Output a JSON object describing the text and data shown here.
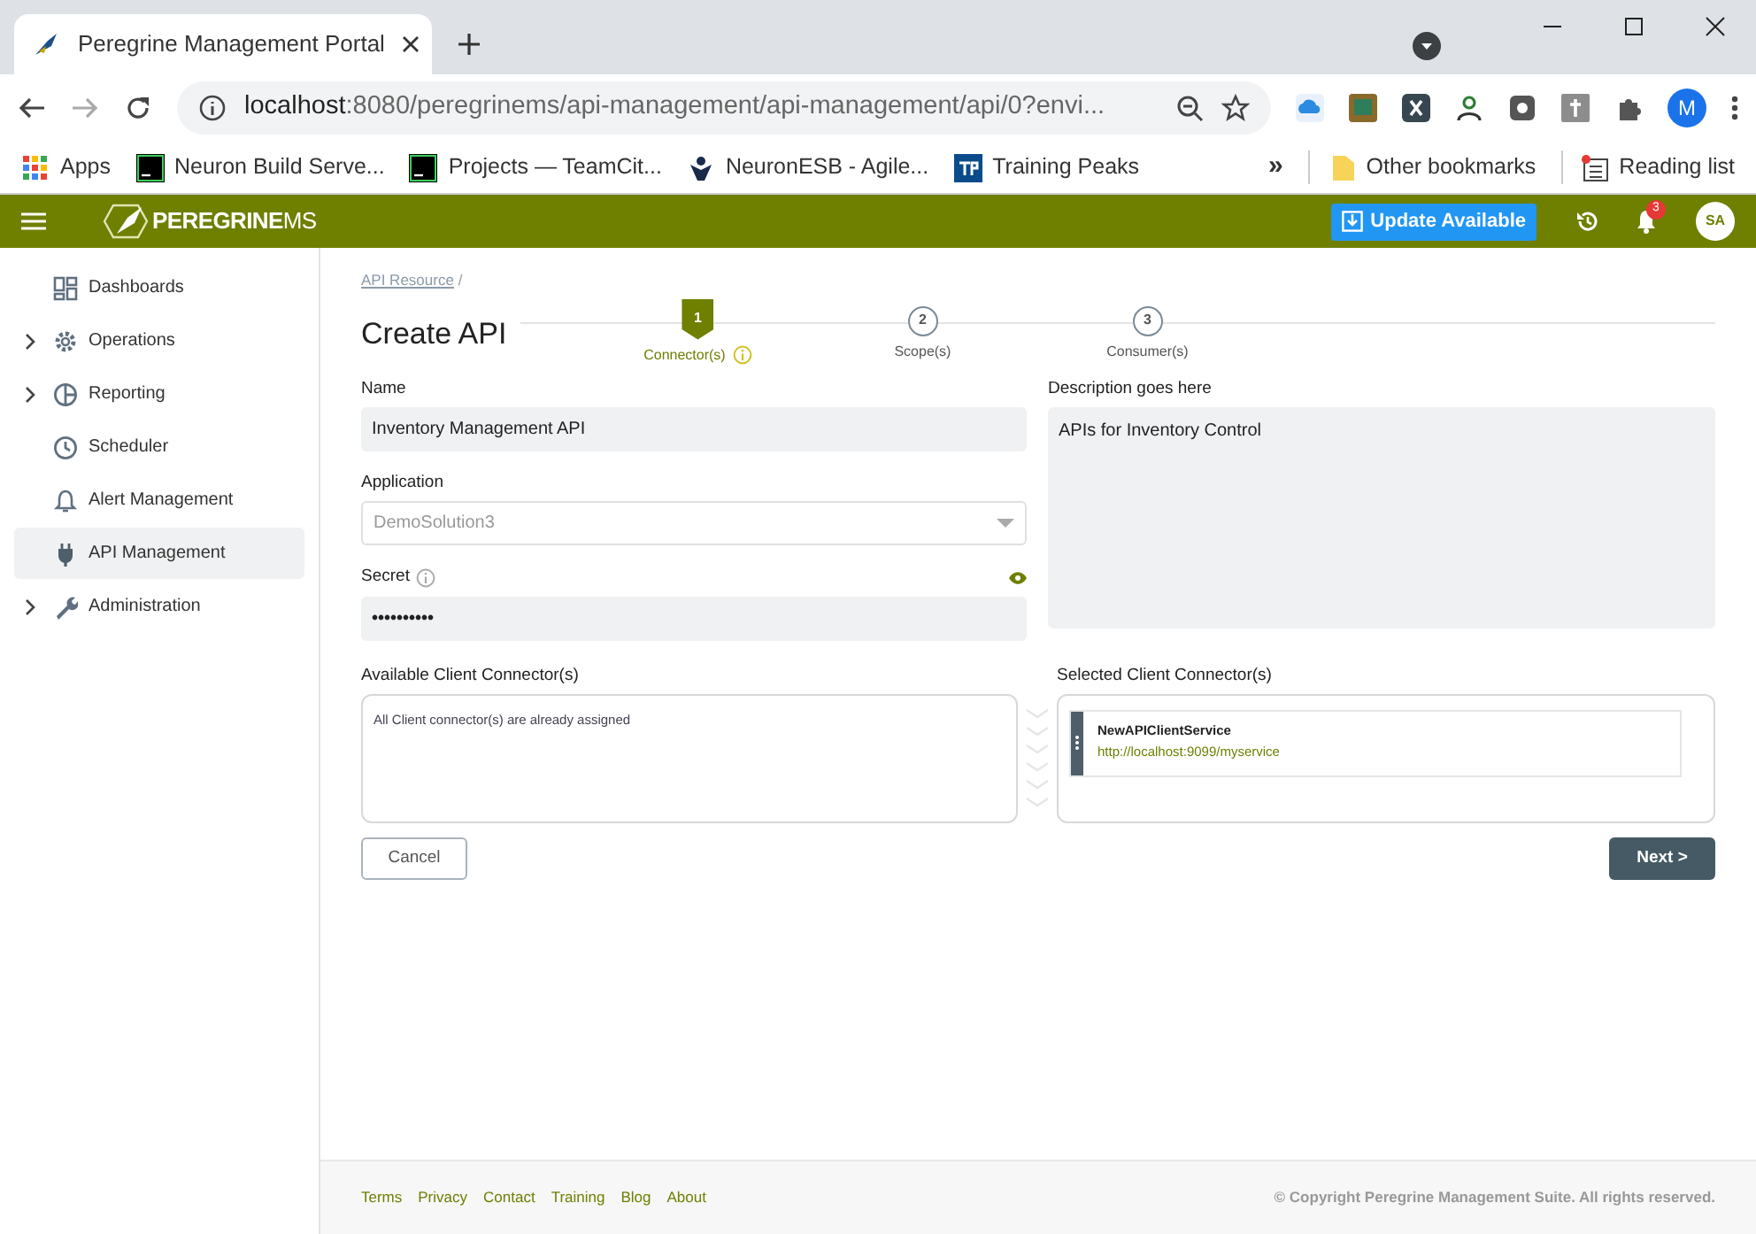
{
  "browser": {
    "tab_title": "Peregrine Management Portal",
    "url_host": "localhost",
    "url_rest": ":8080/peregrinems/api-management/api-management/api/0?envi...",
    "profile": "M",
    "bookmarks": [
      {
        "label": "Apps",
        "kind": "apps"
      },
      {
        "label": "Neuron Build Serve...",
        "kind": "tc"
      },
      {
        "label": "Projects — TeamCit...",
        "kind": "tc"
      },
      {
        "label": "NeuronESB - Agile...",
        "kind": "jira"
      },
      {
        "label": "Training Peaks",
        "kind": "tp"
      }
    ],
    "more": "»",
    "other_bookmarks": "Other bookmarks",
    "reading_list": "Reading list"
  },
  "header": {
    "brand_bold": "PEREGRINE",
    "brand_light": "MS",
    "update_button": "Update Available",
    "notification_count": "3",
    "avatar": "SA"
  },
  "sidebar": {
    "items": [
      {
        "label": "Dashboards",
        "expandable": false,
        "selected": false
      },
      {
        "label": "Operations",
        "expandable": true,
        "selected": false
      },
      {
        "label": "Reporting",
        "expandable": true,
        "selected": false
      },
      {
        "label": "Scheduler",
        "expandable": false,
        "selected": false
      },
      {
        "label": "Alert Management",
        "expandable": false,
        "selected": false
      },
      {
        "label": "API Management",
        "expandable": false,
        "selected": true
      },
      {
        "label": "Administration",
        "expandable": true,
        "selected": false
      }
    ]
  },
  "breadcrumb": {
    "link": "API Resource",
    "separator": "/"
  },
  "title": "Create API",
  "steps": [
    {
      "number": "1",
      "label": "Connector(s)",
      "selected": true,
      "info": true
    },
    {
      "number": "2",
      "label": "Scope(s)",
      "selected": false,
      "info": false
    },
    {
      "number": "3",
      "label": "Consumer(s)",
      "selected": false,
      "info": false
    }
  ],
  "form": {
    "name": {
      "label": "Name",
      "value": "Inventory Management API"
    },
    "application": {
      "label": "Application",
      "value": "DemoSolution3",
      "disabled": true
    },
    "secret": {
      "label": "Secret",
      "value": "••••••••••"
    },
    "description": {
      "label": "Description goes here",
      "value": "APIs for Inventory Control"
    }
  },
  "available_connectors": {
    "label": "Available Client Connector(s)",
    "empty_message": "All Client connector(s) are already assigned"
  },
  "selected_connectors": {
    "label": "Selected Client Connector(s)",
    "items": [
      {
        "name": "NewAPIClientService",
        "url": "http://localhost:9099/myservice"
      }
    ]
  },
  "buttons": {
    "cancel": "Cancel",
    "next": "Next >"
  },
  "footer": {
    "links": [
      "Terms",
      "Privacy",
      "Contact",
      "Training",
      "Blog",
      "About"
    ],
    "copyright": "© Copyright Peregrine Management Suite. All rights reserved."
  }
}
